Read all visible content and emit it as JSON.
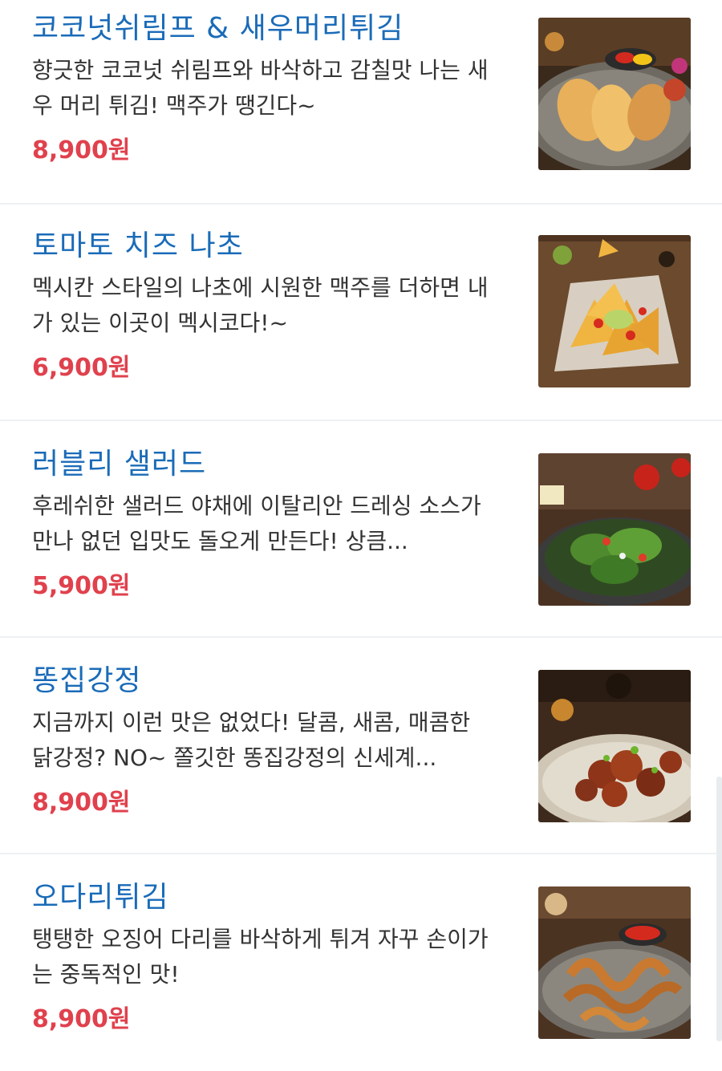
{
  "menu": {
    "items": [
      {
        "name": "코코넛쉬림프 & 새우머리튀김",
        "description": "향긋한 코코넛 쉬림프와 바삭하고 감칠맛 나는 새우 머리 튀김! 맥주가 땡긴다~",
        "price": "8,900원",
        "image_icon": "fried-shrimp-photo"
      },
      {
        "name": "토마토 치즈 나초",
        "description": "멕시칸 스타일의 나초에 시원한 맥주를 더하면 내가 있는 이곳이 멕시코다!~",
        "price": "6,900원",
        "image_icon": "nachos-photo"
      },
      {
        "name": "러블리 샐러드",
        "description": "후레쉬한 샐러드 야채에 이탈리안 드레싱 소스가 만나 없던 입맛도 돌오게 만든다! 상큼...",
        "price": "5,900원",
        "image_icon": "salad-photo"
      },
      {
        "name": "똥집강정",
        "description": "지금까지 이런 맛은 없었다! 달콤, 새콤, 매콤한 닭강정? NO~ 쫄깃한 똥집강정의 신세계...",
        "price": "8,900원",
        "image_icon": "gizzard-gangjeong-photo"
      },
      {
        "name": "오다리튀김",
        "description": "탱탱한 오징어 다리를 바삭하게 튀겨 자꾸 손이가는 중독적인 맛!",
        "price": "8,900원",
        "image_icon": "fried-squid-legs-photo"
      }
    ]
  },
  "colors": {
    "title": "#1a6bb8",
    "price": "#e0414d",
    "description": "#333333",
    "divider": "#eef1f4"
  }
}
